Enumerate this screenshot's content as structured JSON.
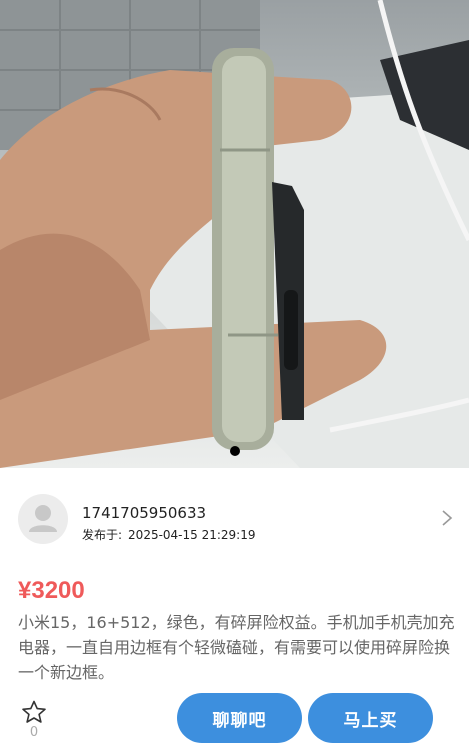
{
  "photo": {
    "description_icon": "product-photo",
    "carousel_dot_color": "#000000"
  },
  "seller": {
    "name": "1741705950633",
    "published_label": "发布于:",
    "published_time": "2025-04-15 21:29:19"
  },
  "listing": {
    "price": "¥3200",
    "description": "小米15，16+512，绿色，有碎屏险权益。手机加手机壳加充 电器，一直自用边框有个轻微磕碰，有需要可以使用碎屏险换一个新边框。"
  },
  "actions": {
    "favorite_count": "0",
    "chat_label": "聊聊吧",
    "buy_label": "马上买"
  },
  "colors": {
    "accent": "#3d8fde",
    "price": "#ef5a5a"
  }
}
